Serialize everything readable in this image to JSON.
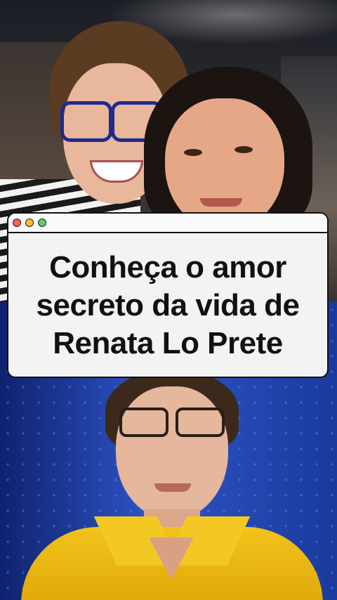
{
  "card": {
    "window_controls": [
      "close-dot",
      "minimize-dot",
      "maximize-dot"
    ],
    "colors": {
      "close": "#ff5f57",
      "minimize": "#febc2e",
      "maximize": "#5bd069",
      "card_background": "#f3f3f3",
      "border": "#111111"
    },
    "headline_lines": [
      "Conheça o amor",
      "secreto da vida de",
      "Renata Lo Prete"
    ]
  },
  "photos": {
    "top": "concert-selfie-photo",
    "bottom": "news-anchor-photo"
  }
}
